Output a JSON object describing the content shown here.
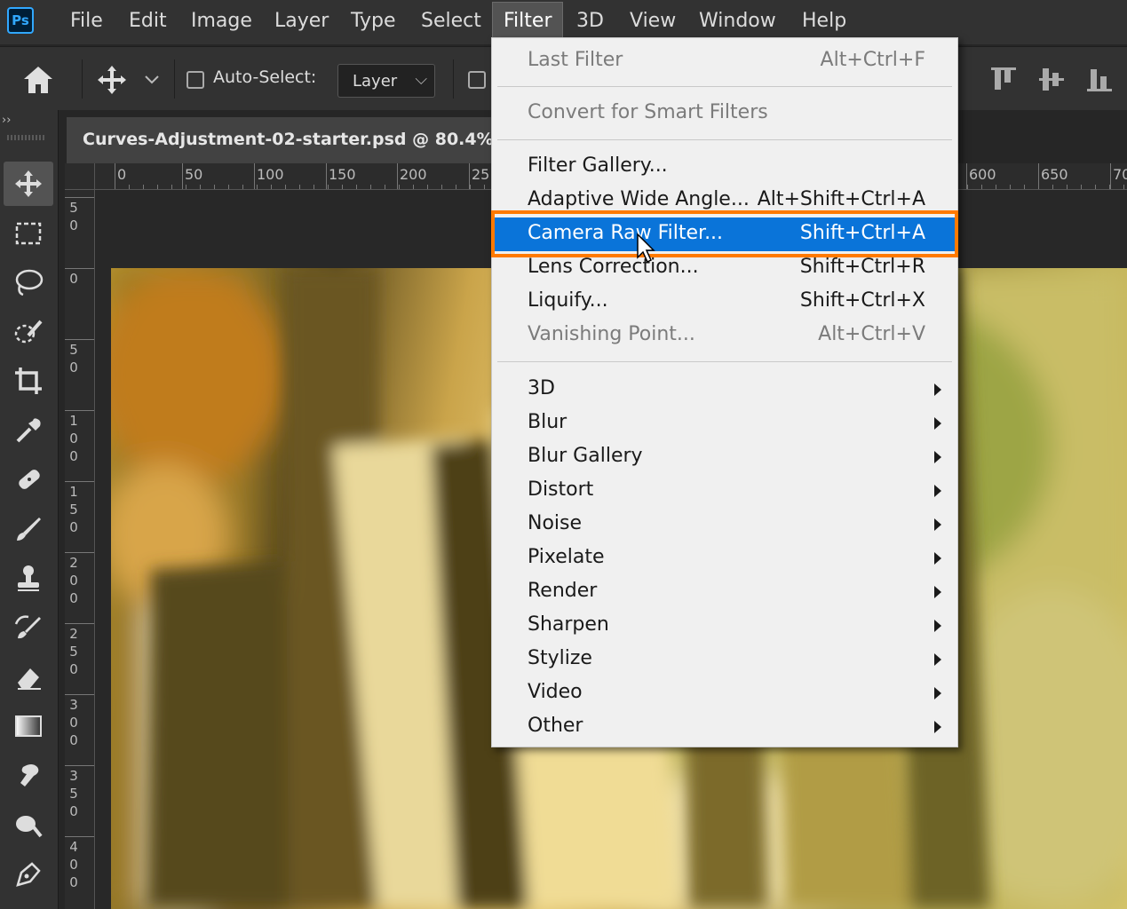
{
  "app": {
    "logo": "Ps"
  },
  "menubar": {
    "items": [
      "File",
      "Edit",
      "Image",
      "Layer",
      "Type",
      "Select",
      "Filter",
      "3D",
      "View",
      "Window",
      "Help"
    ],
    "active": "Filter"
  },
  "options": {
    "auto_select_label": "Auto-Select:",
    "layer_select_value": "Layer",
    "icons": [
      "home-icon",
      "move-icon",
      "chevron-down-icon",
      "align-top-icon",
      "align-vcenter-icon",
      "align-bottom-icon"
    ]
  },
  "document": {
    "tab_title": "Curves-Adjustment-02-starter.psd @ 80.4% ("
  },
  "rulers": {
    "horizontal": [
      "0",
      "50",
      "100",
      "150",
      "200",
      "25",
      "600",
      "650",
      "70"
    ],
    "vertical": [
      [
        "5",
        "0"
      ],
      [
        "0"
      ],
      [
        "5",
        "0"
      ],
      [
        "1",
        "0",
        "0"
      ],
      [
        "1",
        "5",
        "0"
      ],
      [
        "2",
        "0",
        "0"
      ],
      [
        "2",
        "5",
        "0"
      ],
      [
        "3",
        "0",
        "0"
      ],
      [
        "3",
        "5",
        "0"
      ],
      [
        "4",
        "0",
        "0"
      ]
    ]
  },
  "toolbar": {
    "tools": [
      "move-tool-icon",
      "marquee-tool-icon",
      "lasso-tool-icon",
      "quick-select-tool-icon",
      "crop-tool-icon",
      "eyedropper-tool-icon",
      "healing-brush-icon",
      "brush-tool-icon",
      "clone-stamp-icon",
      "history-brush-icon",
      "eraser-tool-icon",
      "gradient-tool-icon",
      "smudge-tool-icon",
      "dodge-tool-icon",
      "pen-tool-icon"
    ]
  },
  "filter_menu": {
    "last_filter": {
      "label": "Last Filter",
      "shortcut": "Alt+Ctrl+F"
    },
    "convert_smart": {
      "label": "Convert for Smart Filters"
    },
    "filter_gallery": {
      "label": "Filter Gallery..."
    },
    "adaptive_wide_angle": {
      "label": "Adaptive Wide Angle...",
      "shortcut": "Alt+Shift+Ctrl+A"
    },
    "camera_raw": {
      "label": "Camera Raw Filter...",
      "shortcut": "Shift+Ctrl+A"
    },
    "lens_correction": {
      "label": "Lens Correction...",
      "shortcut": "Shift+Ctrl+R"
    },
    "liquify": {
      "label": "Liquify...",
      "shortcut": "Shift+Ctrl+X"
    },
    "vanishing_point": {
      "label": "Vanishing Point...",
      "shortcut": "Alt+Ctrl+V"
    },
    "submenus": [
      "3D",
      "Blur",
      "Blur Gallery",
      "Distort",
      "Noise",
      "Pixelate",
      "Render",
      "Sharpen",
      "Stylize",
      "Video",
      "Other"
    ]
  },
  "colors": {
    "highlight_box": "#ff7a00",
    "menu_selection": "#0a74d9",
    "ps_blue": "#31a8ff"
  }
}
